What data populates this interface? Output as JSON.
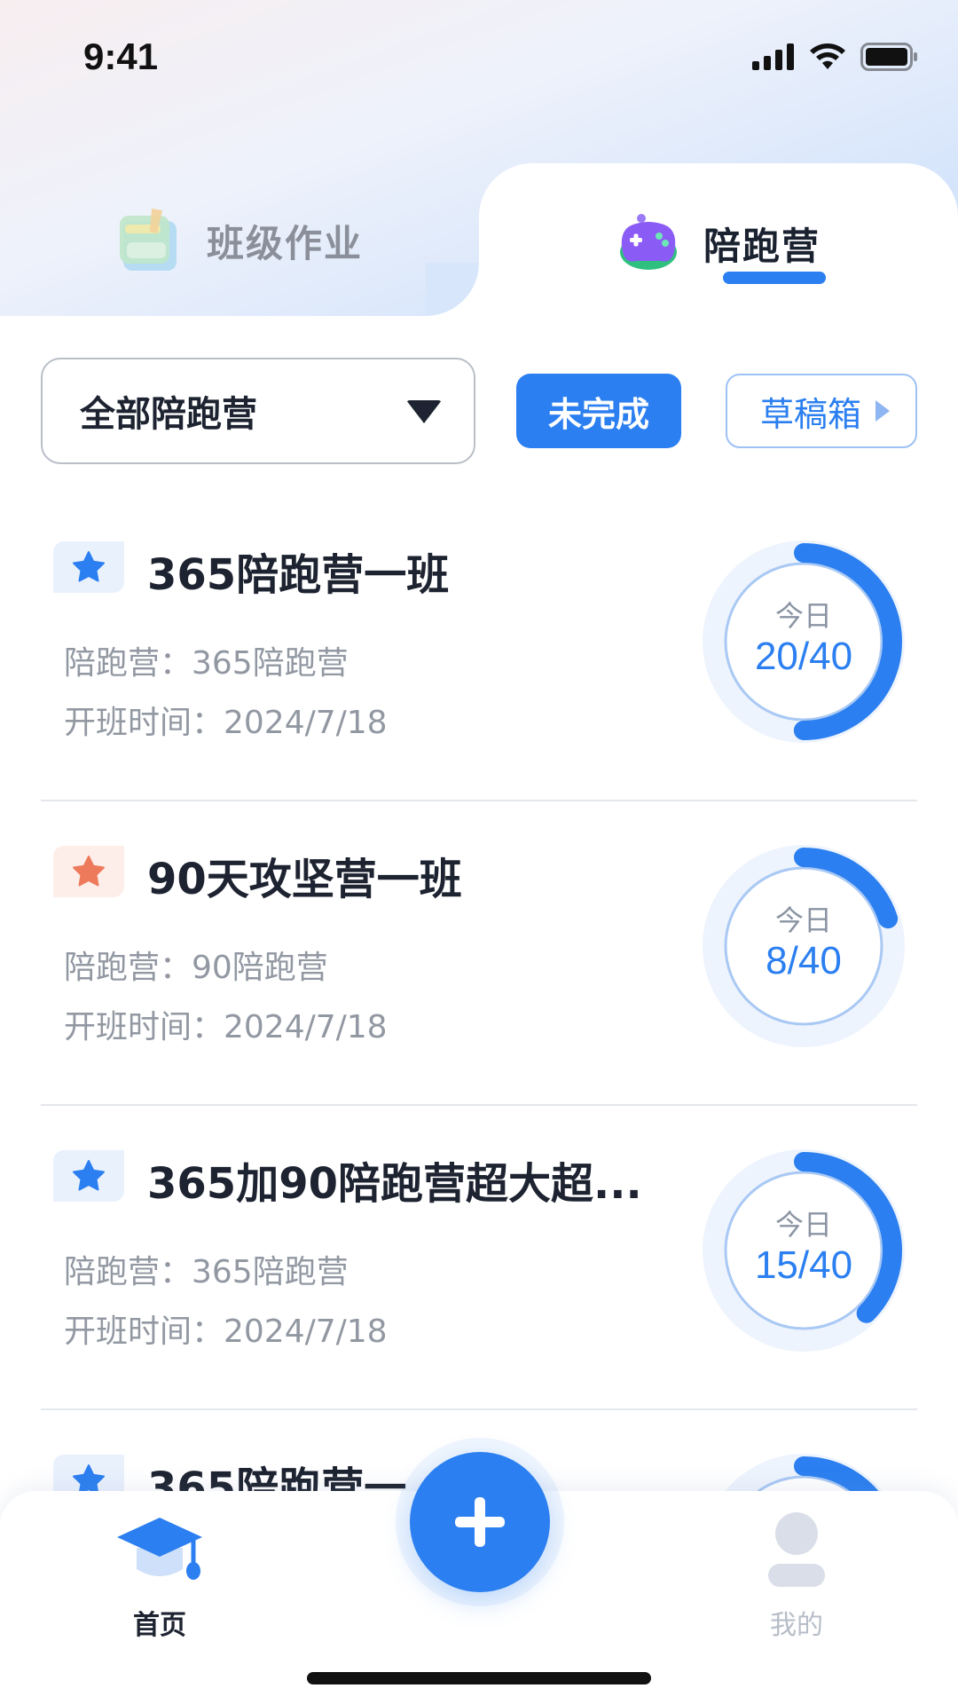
{
  "status_bar": {
    "time": "9:41"
  },
  "tabs": [
    {
      "label": "班级作业",
      "icon": "notebook-icon",
      "active": false
    },
    {
      "label": "陪跑营",
      "icon": "gamepad-icon",
      "active": true
    }
  ],
  "filters": {
    "dropdown_value": "全部陪跑营",
    "undone_label": "未完成",
    "draft_label": "草稿箱"
  },
  "cards": [
    {
      "title": "365陪跑营一班",
      "camp_line": "陪跑营：365陪跑营",
      "start_line": "开班时间：2024/7/18",
      "ring_label": "今日",
      "ring_value": "20/40",
      "progress": 0.5,
      "badge": "blue-star"
    },
    {
      "title": "90天攻坚营一班",
      "camp_line": "陪跑营：90陪跑营",
      "start_line": "开班时间：2024/7/18",
      "ring_label": "今日",
      "ring_value": "8/40",
      "progress": 0.2,
      "badge": "orange-star"
    },
    {
      "title": "365加90陪跑营超大超...",
      "camp_line": "陪跑营：365陪跑营",
      "start_line": "开班时间：2024/7/18",
      "ring_label": "今日",
      "ring_value": "15/40",
      "progress": 0.375,
      "badge": "blue-star"
    },
    {
      "title": "365陪跑营一",
      "camp_line": "",
      "start_line": "",
      "ring_label": "",
      "ring_value": "",
      "progress": 0.2,
      "badge": "blue-star"
    }
  ],
  "bottom_nav": {
    "home_label": "首页",
    "mine_label": "我的",
    "add_icon": "plus-icon"
  },
  "colors": {
    "accent": "#2b7ff0",
    "star_orange": "#ee7a5c"
  }
}
